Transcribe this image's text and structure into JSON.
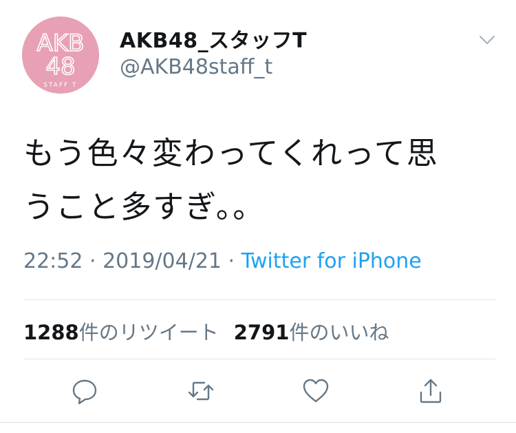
{
  "user": {
    "display_name": "AKB48_スタッフT",
    "handle": "@AKB48staff_t",
    "avatar": {
      "line1": "AKB",
      "line2": "48",
      "line3": "STAFF T",
      "background": "#e8a0b4"
    }
  },
  "tweet": {
    "text_line1": "もう色々変わってくれって思",
    "text_line2": "うこと多すぎ。。"
  },
  "meta": {
    "time": "22:52",
    "separator1": " · ",
    "date": "2019/04/21",
    "separator2": " · ",
    "source": "Twitter for iPhone"
  },
  "stats": {
    "retweets_count": "1288",
    "retweets_label": "件のリツイート",
    "likes_count": "2791",
    "likes_label": "件のいいね"
  },
  "actions": {
    "icons": [
      "reply-icon",
      "retweet-icon",
      "like-icon",
      "share-icon"
    ]
  },
  "colors": {
    "text": "#14171a",
    "secondary": "#657786",
    "link": "#1da1f2",
    "divider": "#dfe3e6"
  }
}
